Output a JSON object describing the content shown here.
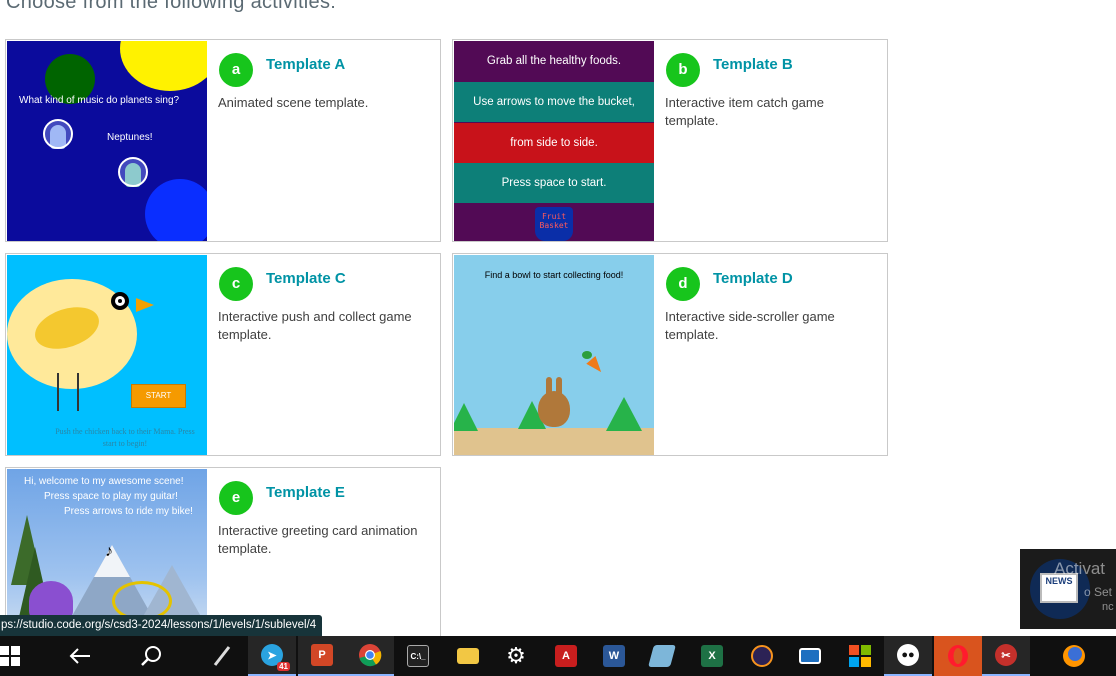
{
  "heading": "Choose from the following activities:",
  "cards": [
    {
      "letter": "a",
      "title": "Template A",
      "description": "Animated scene template.",
      "thumb": {
        "line1": "What kind of music do planets sing?",
        "line2": "Neptunes!"
      }
    },
    {
      "letter": "b",
      "title": "Template B",
      "description": "Interactive item catch game template.",
      "thumb": {
        "rows": [
          "Grab all the healthy foods.",
          "Use arrows to move the bucket,",
          "from side to side.",
          "Press space to start."
        ],
        "bucket": "Fruit Basket"
      }
    },
    {
      "letter": "c",
      "title": "Template C",
      "description": "Interactive push and collect game template.",
      "thumb": {
        "start": "START",
        "hint": "Push the chicken back to their Mama. Press start to begin!"
      }
    },
    {
      "letter": "d",
      "title": "Template D",
      "description": "Interactive side-scroller game template.",
      "thumb": {
        "caption": "Find a bowl to start collecting food!"
      }
    },
    {
      "letter": "e",
      "title": "Template E",
      "description": "Interactive greeting card animation template.",
      "thumb": {
        "line1": "Hi, welcome to my awesome scene!",
        "line2": "Press space to play my guitar!",
        "line3": "Press arrows to ride my bike!",
        "note": "♪"
      }
    }
  ],
  "status_url": "ps://studio.code.org/s/csd3-2024/lessons/1/levels/1/sublevel/4",
  "news": {
    "label": "NEWS",
    "activate": "Activat",
    "sub1": "o Set",
    "sub2": "nc"
  },
  "taskbar": {
    "telegram_badge": "41",
    "items": [
      "start",
      "back",
      "search",
      "pen",
      "telegram",
      "powerpoint",
      "chrome",
      "terminal",
      "explorer",
      "settings",
      "acrobat",
      "word",
      "notes",
      "excel",
      "eclipse",
      "window",
      "tiles",
      "chat",
      "opera",
      "tool",
      "firefox"
    ]
  }
}
